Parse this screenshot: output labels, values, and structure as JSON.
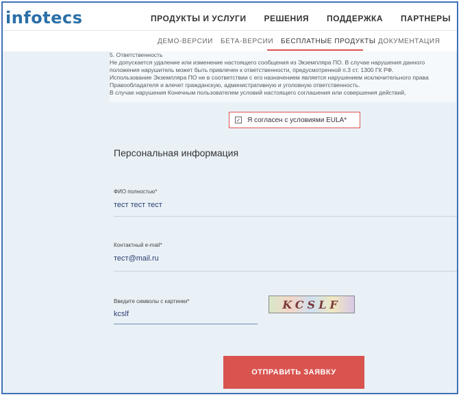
{
  "header": {
    "logo_text": "infotecs",
    "nav": [
      "ПРОДУКТЫ И УСЛУГИ",
      "РЕШЕНИЯ",
      "ПОДДЕРЖКА",
      "ПАРТНЕРЫ"
    ]
  },
  "subnav": {
    "items": [
      "ДЕМО-ВЕРСИИ",
      "БЕТА-ВЕРСИИ",
      "БЕСПЛАТНЫЕ ПРОДУКТЫ",
      "ДОКУМЕНТАЦИЯ"
    ],
    "active": "БЕСПЛАТНЫЕ ПРОДУКТЫ"
  },
  "eula": {
    "lines": [
      "5. Ответственность",
      "Не допускается удаление или изменение настоящего сообщения из Экземпляра ПО. В случае нарушения данного",
      "положения нарушитель может быть привлечен к ответственности, предусмотренной п.3 ст. 1300 ГК РФ.",
      "Использование Экземпляра ПО не в соответствии с его назначением является нарушением исключительного права",
      "Правообладателя и влечет гражданскую, административную и уголовную ответственность.",
      "В случае нарушения Конечным пользователем условий настоящего соглашения или совершения действий,"
    ]
  },
  "agree": {
    "label": "Я согласен с условиями EULA*",
    "checked": true
  },
  "form": {
    "title": "Персональная информация",
    "full_name": {
      "label": "ФИО полностью*",
      "value": "тест тест тест"
    },
    "email": {
      "label": "Контактный e-mail*",
      "value": "тест@mail.ru"
    },
    "captcha": {
      "label": "Введите символы с картинки*",
      "value": "kcslf",
      "image_text": "KCSLF"
    },
    "submit_label": "ОТПРАВИТЬ ЗАЯВКУ"
  },
  "colors": {
    "accent": "#d9534f",
    "brand": "#2b6fa8",
    "form_background": "#e9f1f7"
  }
}
